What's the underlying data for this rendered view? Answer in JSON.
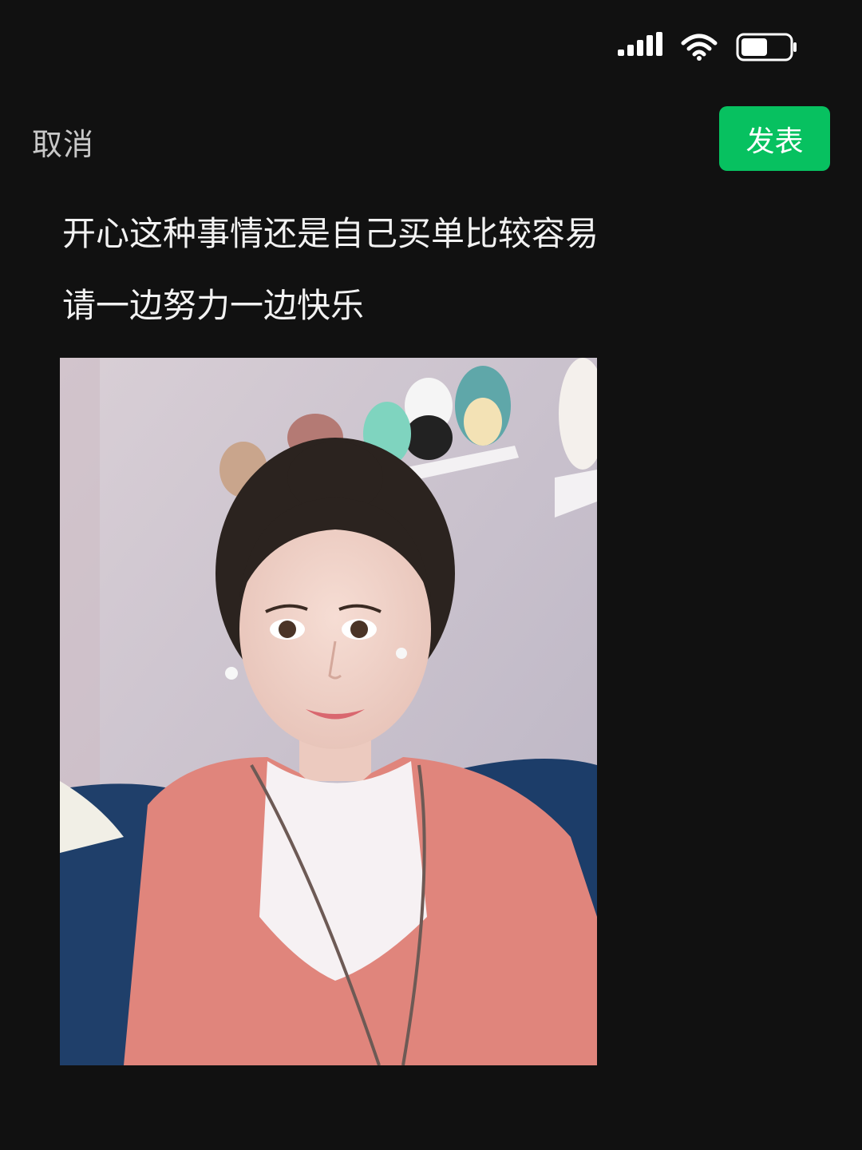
{
  "status_bar": {
    "signal_icon": "signal-bars-icon",
    "wifi_icon": "wifi-icon",
    "battery_icon": "battery-icon",
    "battery_level": 0.55
  },
  "header": {
    "cancel_label": "取消",
    "publish_label": "发表",
    "publish_color": "#07c160"
  },
  "post": {
    "lines": [
      "开心这种事情还是自己买单比较容易",
      "请一边努力一边快乐"
    ]
  }
}
